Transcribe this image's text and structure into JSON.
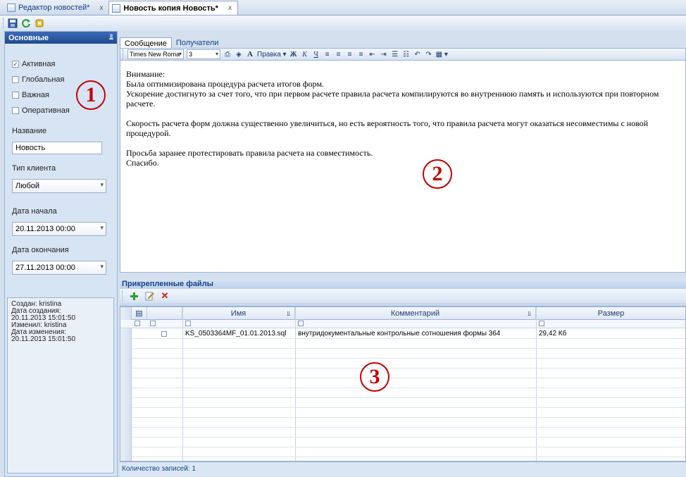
{
  "document_tabs": [
    {
      "label": "Редактор новостей*",
      "close": "x"
    },
    {
      "label": "Новость копия Новость*",
      "close": "x"
    }
  ],
  "left_panel": {
    "header": "Основные",
    "pin": "ᵖ",
    "checkboxes": [
      {
        "label": "Активная",
        "checked": true
      },
      {
        "label": "Глобальная",
        "checked": false
      },
      {
        "label": "Важная",
        "checked": false
      },
      {
        "label": "Оперативная",
        "checked": false
      }
    ],
    "name_label": "Название",
    "name_value": "Новость",
    "client_type_label": "Тип клиента",
    "client_type_value": "Любой",
    "start_date_label": "Дата начала",
    "start_date_value": "20.11.2013 00:00",
    "end_date_label": "Дата окончания",
    "end_date_value": "27.11.2013 00:00",
    "info": {
      "created_by": "Создан: kristina",
      "created_label": "Дата создания:",
      "created_date": "20.11.2013 15:01:50",
      "modified_by": "Изменил: kristina",
      "modified_label": "Дата изменения:",
      "modified_date": "20.11.2013 15:01:50"
    }
  },
  "editor": {
    "tabs": [
      "Сообщение",
      "Получатели"
    ],
    "font": "Times New Roma",
    "size": "3",
    "edit_menu": "Правка",
    "bold": "Ж",
    "italic": "К",
    "underline": "Ч",
    "lines": [
      "Внимание:",
      "Была оптимизирована процедура расчета итогов форм.",
      "Ускорение достигнуто за счет того, что при первом расчете правила расчета компилируются во внутреннюю память и используются при повторном расчете.",
      "",
      "Скорость расчета форм должна существенно увеличиться, но есть вероятность того, что правила расчета могут оказаться несовместимы с новой процедурой.",
      "",
      "Просьба заранее протестировать правила расчета на совместимость.",
      "Спасибо."
    ]
  },
  "files": {
    "header": "Прикрепленные файлы",
    "columns": [
      "Имя",
      "Комментарий",
      "Размер"
    ],
    "rows": [
      {
        "name": "KS_0503364MF_01.01.2013.sql",
        "comment": "внутридокументальные контрольные сотношения формы 364",
        "size": "29,42 Кб"
      }
    ],
    "status": "Количество записей: 1"
  },
  "markers": [
    "1",
    "2",
    "3"
  ],
  "colors": {
    "accent": "#1f4a91",
    "marker": "#c00000"
  }
}
